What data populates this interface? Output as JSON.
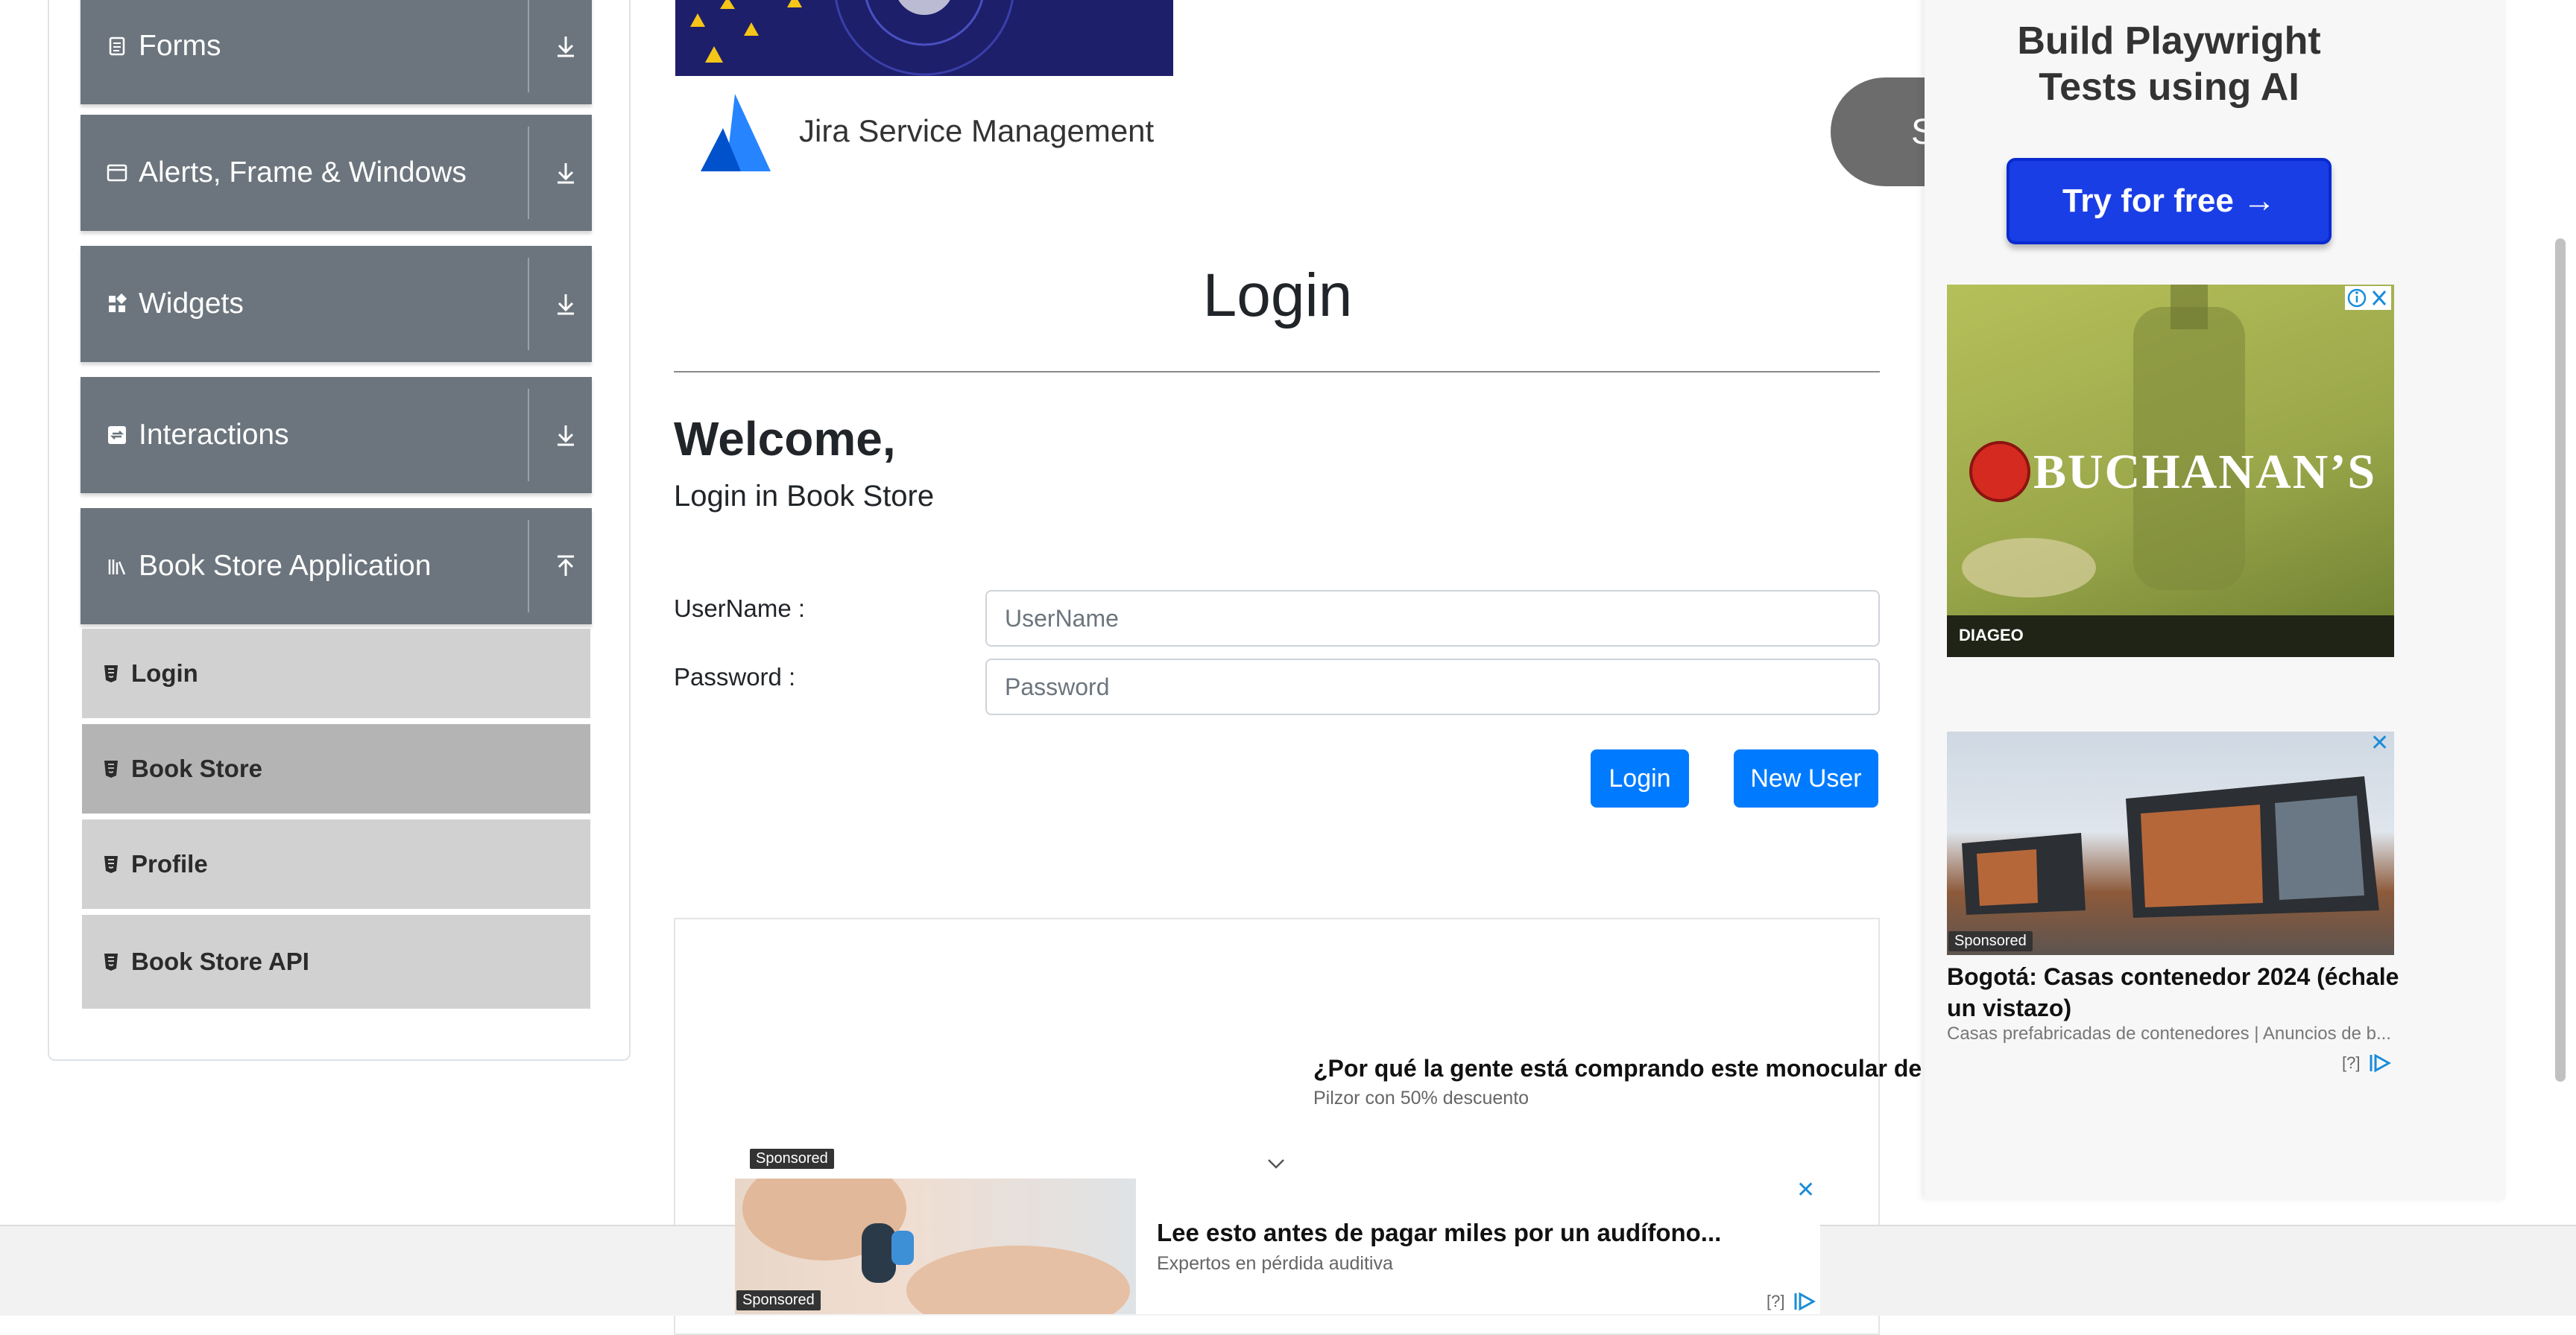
{
  "sidebar": {
    "groups": [
      {
        "label": "Forms",
        "icon": "document-icon",
        "expanded": false
      },
      {
        "label": "Alerts, Frame & Windows",
        "icon": "window-icon",
        "expanded": false
      },
      {
        "label": "Widgets",
        "icon": "widgets-icon",
        "expanded": false
      },
      {
        "label": "Interactions",
        "icon": "interactions-icon",
        "expanded": false
      },
      {
        "label": "Book Store Application",
        "icon": "library-icon",
        "expanded": true
      }
    ],
    "items": [
      {
        "label": "Login",
        "active": false
      },
      {
        "label": "Book Store",
        "active": true
      },
      {
        "label": "Profile",
        "active": false
      },
      {
        "label": "Book Store API",
        "active": false
      }
    ]
  },
  "header_ad": {
    "brand": "Jira Service Management",
    "button_partial": "S"
  },
  "login": {
    "title": "Login",
    "welcome": "Welcome,",
    "subtitle": "Login in Book Store",
    "username_label": "UserName :",
    "username_placeholder": "UserName",
    "username_value": "",
    "password_label": "Password :",
    "password_placeholder": "Password",
    "password_value": "",
    "login_button": "Login",
    "new_user_button": "New User"
  },
  "ads": {
    "playwright": {
      "title": "Build Playwright Tests using AI",
      "button": "Try for free →"
    },
    "buchanans": {
      "brand": "BUCHANAN’S",
      "footer": "DIAGEO"
    },
    "casas": {
      "sponsored": "Sponsored",
      "title": "Bogotá: Casas contenedor 2024 (échale un vistazo)",
      "source": "Casas prefabricadas de contenedores | Anuncios de b...",
      "help": "[?]"
    },
    "monocular": {
      "title": "¿Por qué la gente está comprando este monocular de",
      "source": "Pilzor con 50% descuento",
      "sponsored": "Sponsored"
    },
    "audifono": {
      "title": "Lee esto antes de pagar miles por un audífono...",
      "source": "Expertos en pérdida auditiva",
      "sponsored": "Sponsored",
      "help": "[?]"
    }
  },
  "colors": {
    "sidebar_header": "#6c757d",
    "menu_item": "#d1d1d1",
    "menu_item_active": "#b4b4b4",
    "primary": "#007bff",
    "playwright_button": "#1a3ee6"
  }
}
